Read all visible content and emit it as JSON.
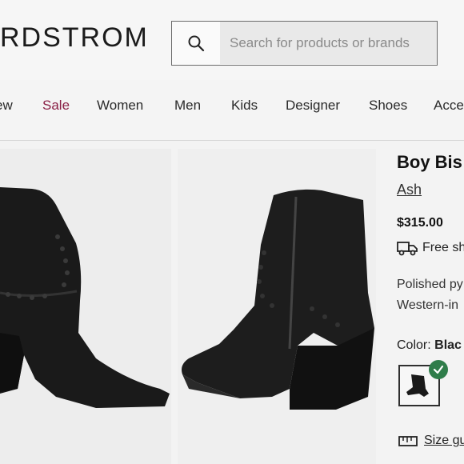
{
  "header": {
    "logo": "RDSTROM",
    "search_placeholder": "Search for products or brands"
  },
  "nav": {
    "items": [
      "ew",
      "Sale",
      "Women",
      "Men",
      "Kids",
      "Designer",
      "Shoes",
      "Acce"
    ]
  },
  "product": {
    "title": "Boy Bis",
    "brand": "Ash",
    "price": "$315.00",
    "shipping": "Free sh",
    "description_lines": [
      "Polished py",
      "Western-in"
    ],
    "color_label": "Color:",
    "color_value": "Blac",
    "size_guide": "Size gu"
  },
  "colors": {
    "sale": "#8a2046",
    "check": "#2f7d4a"
  }
}
